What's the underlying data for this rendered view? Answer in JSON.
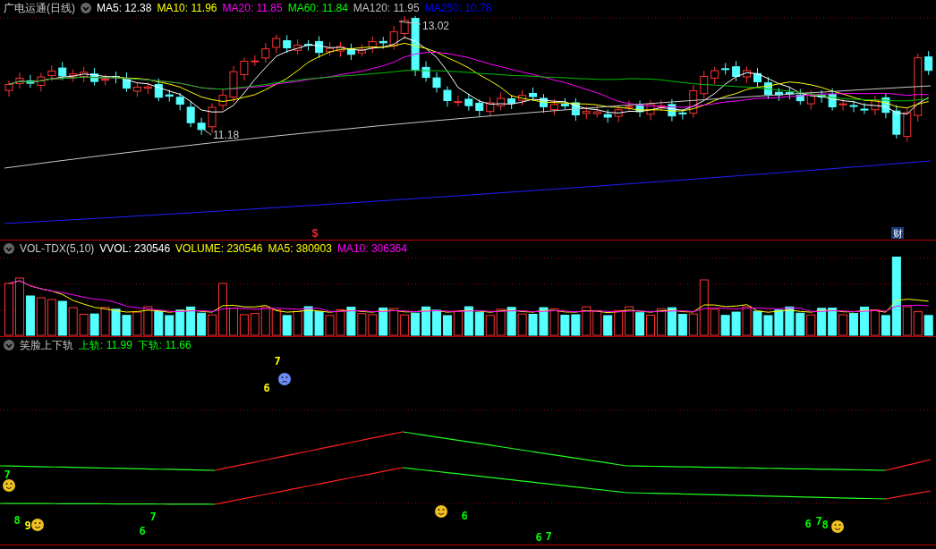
{
  "price_panel": {
    "title": "广电运通(日线)",
    "indicators": [
      {
        "label": "MA5: 12.38",
        "color": "#ffffff"
      },
      {
        "label": "MA10: 11.96",
        "color": "#ffff00"
      },
      {
        "label": "MA20: 11.85",
        "color": "#ff00ff"
      },
      {
        "label": "MA60: 11.84",
        "color": "#00ff00"
      },
      {
        "label": "MA120: 11.95",
        "color": "#c0c0c0"
      },
      {
        "label": "MA250: 10.78",
        "color": "#0000ff"
      }
    ],
    "high_label": "13.02",
    "low_label": "11.18",
    "markers": [
      {
        "kind": "dollar",
        "text": "$"
      },
      {
        "kind": "finance",
        "text": "财"
      }
    ]
  },
  "volume_panel": {
    "title": "VOL-TDX(5,10)",
    "indicators": [
      {
        "label": "VVOL: 230546",
        "color": "#ffffff"
      },
      {
        "label": "VOLUME: 230546",
        "color": "#ffff00"
      },
      {
        "label": "MA5: 380903",
        "color": "#ffff00"
      },
      {
        "label": "MA10: 306364",
        "color": "#ff00ff"
      }
    ]
  },
  "indicator_panel": {
    "title": "笑脸上下轨",
    "indicators": [
      {
        "label": "上轨: 11.99",
        "color": "#00ff00"
      },
      {
        "label": "下轨: 11.66",
        "color": "#00ff00"
      }
    ],
    "signals": [
      {
        "kind": "digit",
        "text": "7",
        "color": "#ffff00"
      },
      {
        "kind": "digit",
        "text": "6",
        "color": "#ffff00"
      },
      {
        "kind": "sad"
      },
      {
        "kind": "digit",
        "text": "7",
        "color": "#00ff00"
      },
      {
        "kind": "smile"
      },
      {
        "kind": "digit",
        "text": "8",
        "color": "#00ff00"
      },
      {
        "kind": "digit",
        "text": "9",
        "color": "#ffff00"
      },
      {
        "kind": "smile"
      },
      {
        "kind": "digit",
        "text": "7",
        "color": "#00ff00"
      },
      {
        "kind": "digit",
        "text": "6",
        "color": "#00ff00"
      },
      {
        "kind": "smile"
      },
      {
        "kind": "digit",
        "text": "6",
        "color": "#00ff00"
      },
      {
        "kind": "digit",
        "text": "6",
        "color": "#00ff00"
      },
      {
        "kind": "digit",
        "text": "7",
        "color": "#00ff00"
      },
      {
        "kind": "digit",
        "text": "6",
        "color": "#00ff00"
      },
      {
        "kind": "digit",
        "text": "7",
        "color": "#00ff00"
      },
      {
        "kind": "digit",
        "text": "8",
        "color": "#00ff00"
      },
      {
        "kind": "smile"
      }
    ]
  }
}
